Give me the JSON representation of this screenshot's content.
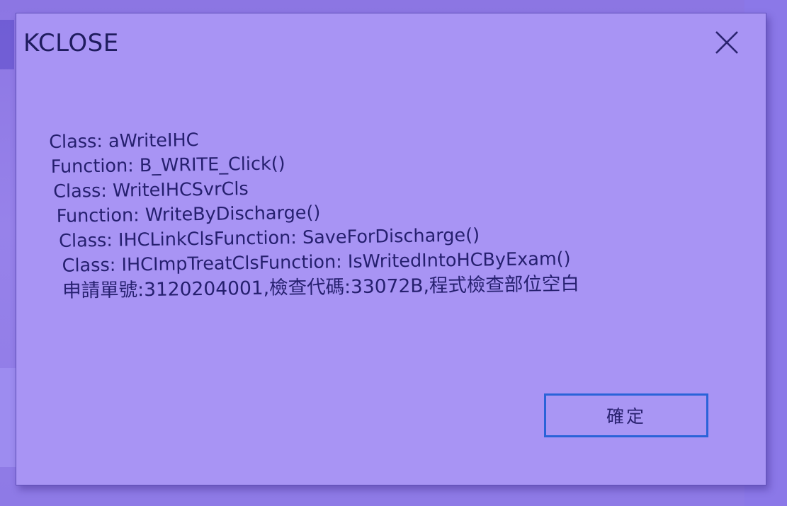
{
  "dialog": {
    "title": "KCLOSE",
    "close_icon": "close-icon",
    "message_lines": [
      "Class: aWriteIHC",
      "Function: B_WRITE_Click()",
      "Class: WriteIHCSvrCls",
      "Function: WriteByDischarge()",
      "Class: IHCLinkClsFunction: SaveForDischarge()",
      "Class: IHCImpTreatClsFunction: IsWritedIntoHCByExam()",
      "申請單號:3120204001,檢查代碼:33072B,程式檢查部位空白"
    ],
    "ok_label": "確定"
  },
  "colors": {
    "dialog_bg": "#a894f4",
    "text": "#251f6e",
    "button_border": "#2a63d8"
  }
}
